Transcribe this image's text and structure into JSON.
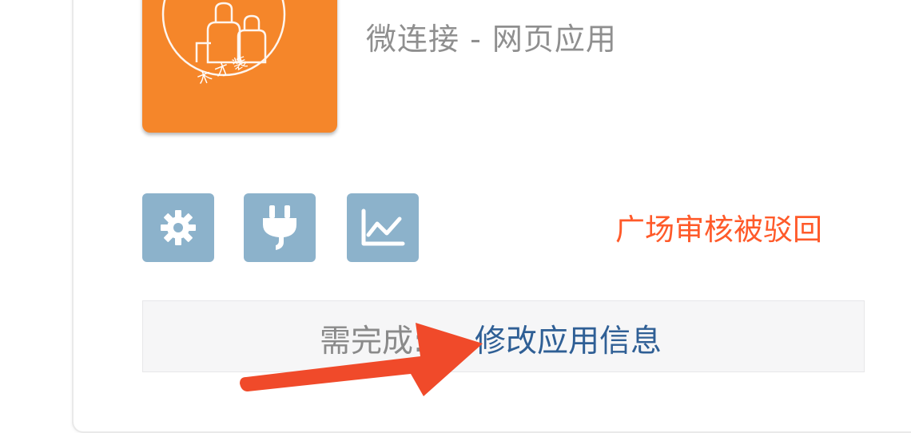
{
  "app": {
    "subtitle": "微连接 - 网页应用",
    "logo_text": "木 才 装"
  },
  "actions": {
    "settings_icon": "gear-icon",
    "plugin_icon": "plug-icon",
    "stats_icon": "line-chart-icon"
  },
  "status": {
    "review_text": "广场审核被驳回",
    "color": "#ff5a2a"
  },
  "todo": {
    "prefix": "需完成:",
    "link_text": "修改应用信息"
  },
  "colors": {
    "logo_bg": "#f5862a",
    "button_bg": "#8cb2cb",
    "link": "#2f5f95",
    "annotation_arrow": "#f04a2a"
  }
}
